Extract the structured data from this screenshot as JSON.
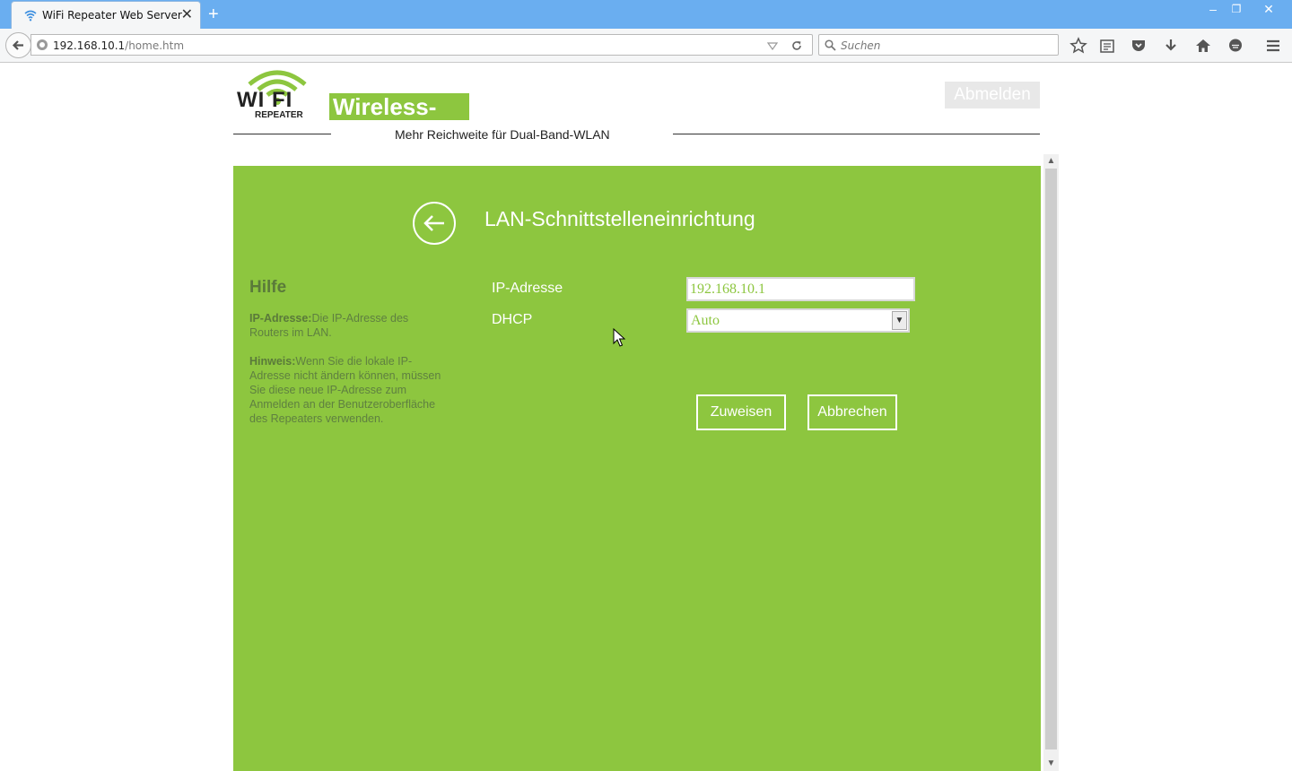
{
  "browser": {
    "tab_title": "WiFi Repeater Web Server",
    "new_tab_label": "+",
    "url_host": "192.168.10.1",
    "url_path": "/home.htm",
    "search_placeholder": "Suchen",
    "window_minimize": "–",
    "window_restore": "❐",
    "window_close": "✕",
    "tab_close": "✕"
  },
  "header": {
    "logo_top": "WI  FI",
    "logo_bottom": "REPEATER",
    "brand": "Wireless-AC",
    "tagline": "Mehr Reichweite für Dual-Band-WLAN",
    "logout_label": "Abmelden"
  },
  "main": {
    "title": "LAN-Schnittstelleneinrichtung",
    "help": {
      "title": "Hilfe",
      "ip_term": "IP-Adresse:",
      "ip_text": "Die IP-Adresse des Routers im LAN.",
      "hint_term": "Hinweis:",
      "hint_text": "Wenn Sie die lokale IP-Adresse nicht ändern können, müssen Sie diese neue IP-Adresse zum Anmelden an der Benutzeroberfläche des Repeaters verwenden."
    },
    "form": {
      "ip_label": "IP-Adresse",
      "ip_value": "192.168.10.1",
      "dhcp_label": "DHCP",
      "dhcp_value": "Auto"
    },
    "buttons": {
      "assign": "Zuweisen",
      "cancel": "Abbrechen"
    }
  },
  "colors": {
    "accent": "#8dc63f",
    "titlebar": "#6aaef0"
  }
}
